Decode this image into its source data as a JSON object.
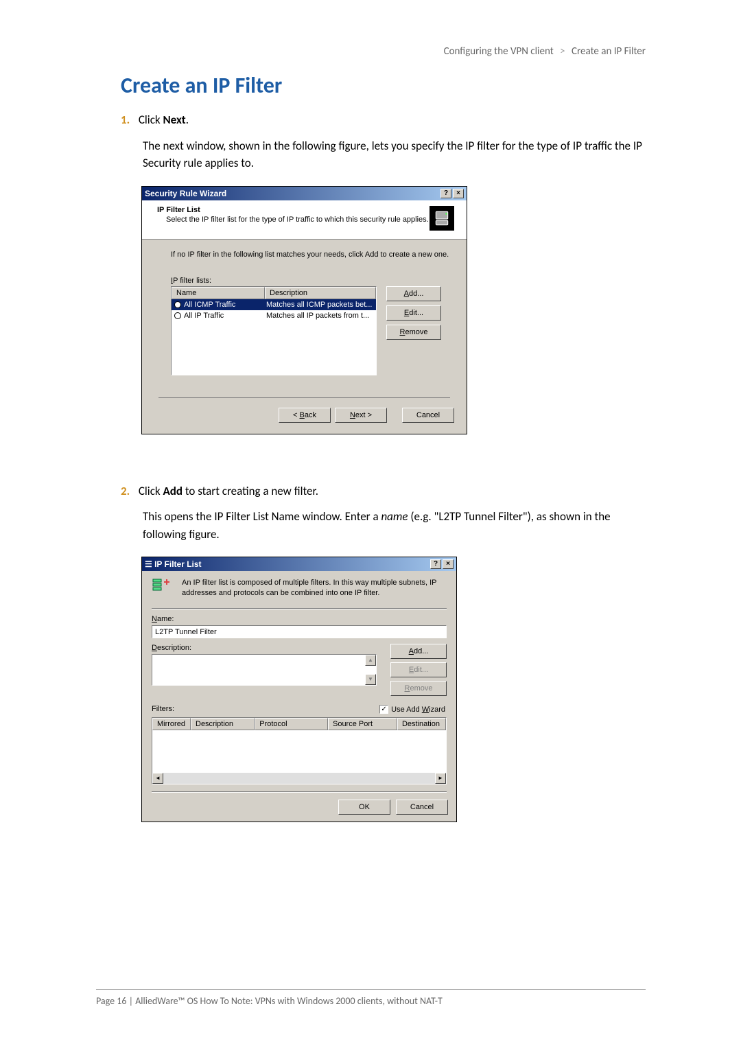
{
  "header": {
    "left": "Configuring the VPN client",
    "right": "Create an IP Filter"
  },
  "title": "Create an IP Filter",
  "step1": {
    "num": "1.",
    "pre": "Click ",
    "bold": "Next",
    "post": ".",
    "body": "The next window, shown in the following figure, lets you specify the IP filter for the type of IP traffic the IP Security rule applies to."
  },
  "dlg1": {
    "title": "Security Rule Wizard",
    "hdr_title": "IP Filter List",
    "hdr_sub": "Select the IP filter list for the type of IP traffic to which this security rule applies.",
    "intro": "If no IP filter in the following list matches your needs, click Add to create a new one.",
    "list_label": "IP filter lists:",
    "col1": "Name",
    "col2": "Description",
    "row1_name": "All ICMP Traffic",
    "row1_desc": "Matches all ICMP packets bet...",
    "row2_name": "All IP Traffic",
    "row2_desc": "Matches all IP packets from t...",
    "btn_add": "Add...",
    "btn_edit": "Edit...",
    "btn_remove": "Remove",
    "btn_back": "< Back",
    "btn_next": "Next >",
    "btn_cancel": "Cancel"
  },
  "step2": {
    "num": "2.",
    "pre": "Click ",
    "bold": "Add",
    "post": " to start creating a new filter.",
    "body_pre": "This opens the IP Filter List Name window. Enter a ",
    "body_italic": "name",
    "body_post": " (e.g. \"L2TP Tunnel Filter\"), as shown in the following figure."
  },
  "dlg2": {
    "title": "IP Filter List",
    "desc": "An IP filter list is composed of multiple filters. In this way multiple subnets, IP addresses and protocols can be combined into one IP filter.",
    "name_lbl": "Name:",
    "name_val": "L2TP Tunnel Filter",
    "desc_lbl": "Description:",
    "btn_add": "Add...",
    "btn_edit": "Edit...",
    "btn_remove": "Remove",
    "wizard_lbl": "Use Add Wizard",
    "filters_lbl": "Filters:",
    "fcol1": "Mirrored",
    "fcol2": "Description",
    "fcol3": "Protocol",
    "fcol4": "Source Port",
    "fcol5": "Destination",
    "btn_ok": "OK",
    "btn_cancel": "Cancel"
  },
  "footer": "Page 16 | AlliedWare™ OS How To Note: VPNs with Windows 2000 clients, without NAT-T"
}
